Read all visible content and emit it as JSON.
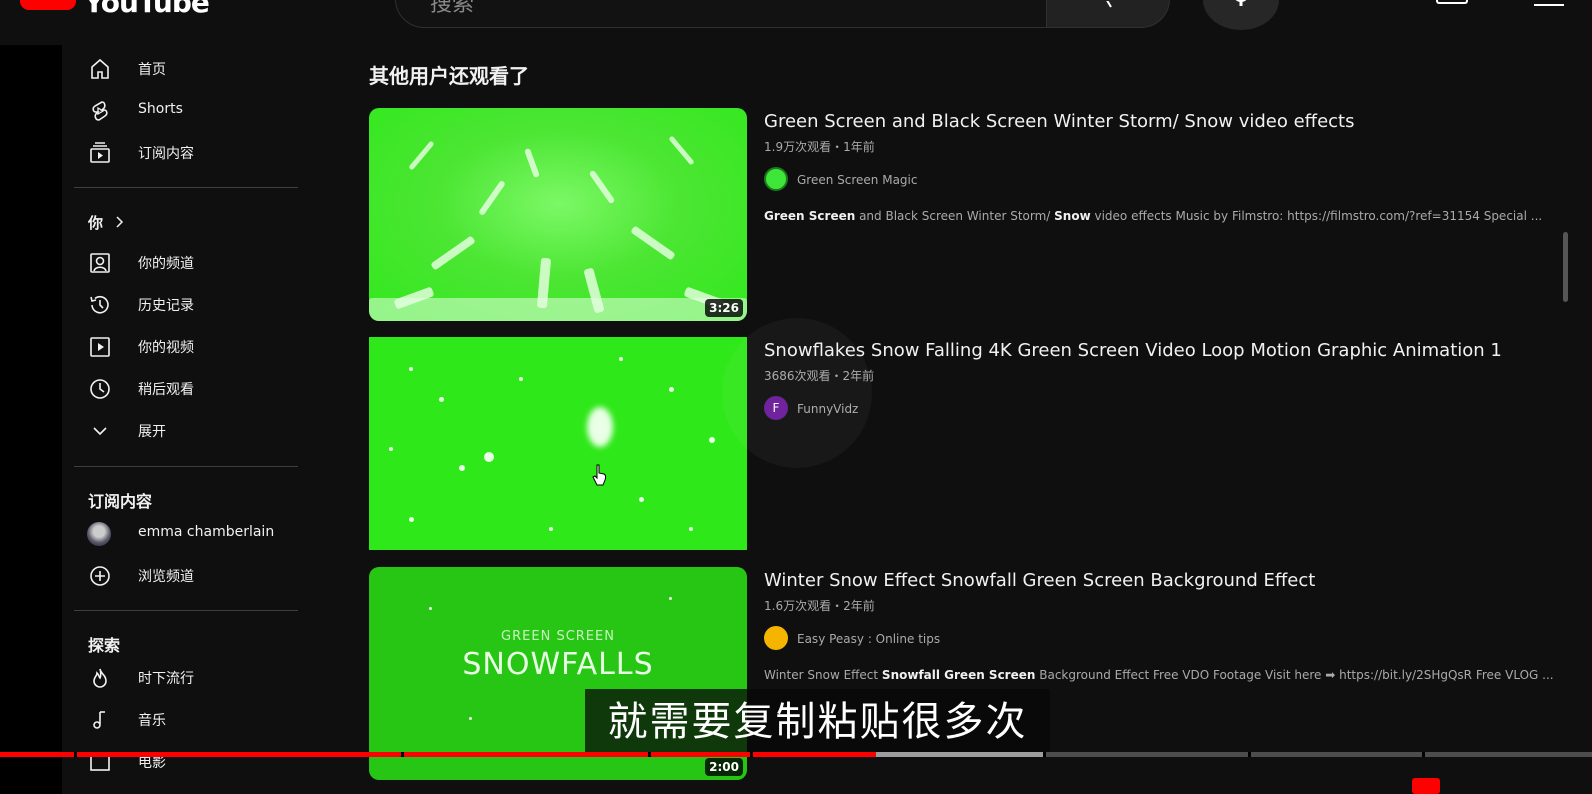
{
  "header": {
    "logo_text": "YouTube",
    "search_placeholder": "搜索"
  },
  "sidebar": {
    "main": [
      {
        "label": "首页",
        "icon": "home-icon"
      },
      {
        "label": "Shorts",
        "icon": "shorts-icon"
      },
      {
        "label": "订阅内容",
        "icon": "subscriptions-icon"
      }
    ],
    "you_title": "你",
    "you_items": [
      {
        "label": "你的频道",
        "icon": "your-channel-icon"
      },
      {
        "label": "历史记录",
        "icon": "history-icon"
      },
      {
        "label": "你的视频",
        "icon": "your-videos-icon"
      },
      {
        "label": "稍后观看",
        "icon": "watch-later-icon"
      },
      {
        "label": "展开",
        "icon": "chevron-down-icon"
      }
    ],
    "subs_title": "订阅内容",
    "subs_items": [
      {
        "label": "emma chamberlain"
      },
      {
        "label": "浏览频道",
        "icon": "add-circle-icon"
      }
    ],
    "explore_title": "探索",
    "explore_items": [
      {
        "label": "时下流行",
        "icon": "trending-icon"
      },
      {
        "label": "音乐",
        "icon": "music-icon"
      },
      {
        "label": "电影",
        "icon": "movies-icon"
      }
    ]
  },
  "main": {
    "section_title": "其他用户还观看了",
    "videos": [
      {
        "title": "Green Screen and Black Screen Winter Storm/ Snow video effects",
        "meta": "1.9万次观看・1年前",
        "channel": "Green Screen Magic",
        "duration": "3:26",
        "desc_b1": "Green Screen",
        "desc_t1": " and Black Screen Winter Storm/ ",
        "desc_b2": "Snow",
        "desc_t2": " video effects Music by Filmstro: https://filmstro.com/?ref=31154 Special ..."
      },
      {
        "title": "Snowflakes Snow Falling 4K Green Screen Video Loop Motion Graphic Animation 1",
        "meta": "3686次观看・2年前",
        "channel": "FunnyVidz",
        "channel_initial": "F"
      },
      {
        "title": "Winter Snow Effect Snowfall Green Screen Background Effect",
        "meta": "1.6万次观看・2年前",
        "channel": "Easy Peasy : Online tips",
        "duration": "2:00",
        "thumb_small": "GREEN SCREEN",
        "thumb_big": "SNOWFALLS",
        "desc_t1": "Winter Snow Effect ",
        "desc_b1": "Snowfall Green Screen",
        "desc_t2": " Background Effect Free VDO Footage Visit here ➡ https://bit.ly/2SHgQsR Free VLOG ..."
      }
    ]
  },
  "player": {
    "subtitle": "就需要复制粘贴很多次",
    "progress_fraction": 0.55,
    "colors": {
      "played": "#ff0000",
      "buffered": "#9e9e9e",
      "track": "#4d4d4d"
    }
  }
}
